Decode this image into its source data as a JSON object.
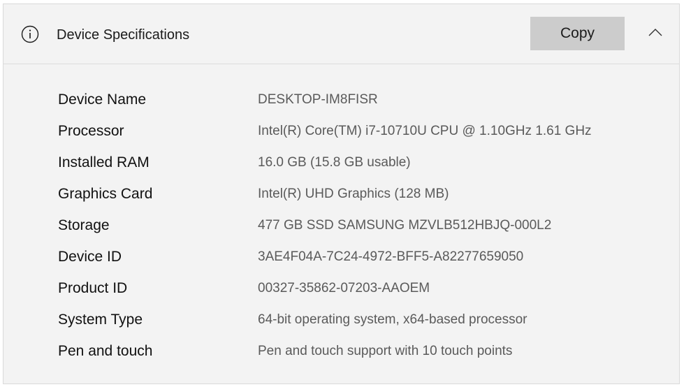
{
  "header": {
    "title": "Device Specifications",
    "copy_label": "Copy",
    "info_icon": "info-icon",
    "collapse_icon": "chevron-up-icon"
  },
  "specs": [
    {
      "label": "Device Name",
      "value": "DESKTOP-IM8FISR"
    },
    {
      "label": "Processor",
      "value": "Intel(R) Core(TM) i7-10710U CPU @ 1.10GHz   1.61 GHz"
    },
    {
      "label": "Installed RAM",
      "value": "16.0 GB (15.8 GB usable)"
    },
    {
      "label": "Graphics Card",
      "value": "Intel(R) UHD Graphics (128 MB)"
    },
    {
      "label": "Storage",
      "value": "477 GB SSD SAMSUNG MZVLB512HBJQ-000L2"
    },
    {
      "label": "Device ID",
      "value": "3AE4F04A-7C24-4972-BFF5-A82277659050"
    },
    {
      "label": "Product ID",
      "value": "00327-35862-07203-AAOEM"
    },
    {
      "label": "System Type",
      "value": "64-bit operating system, x64-based processor"
    },
    {
      "label": "Pen and touch",
      "value": "Pen and touch support with 10 touch points"
    }
  ],
  "colors": {
    "panel_background": "#f3f3f3",
    "button_background": "#cccccc",
    "label_text": "#111111",
    "value_text": "#5a5a5a"
  }
}
